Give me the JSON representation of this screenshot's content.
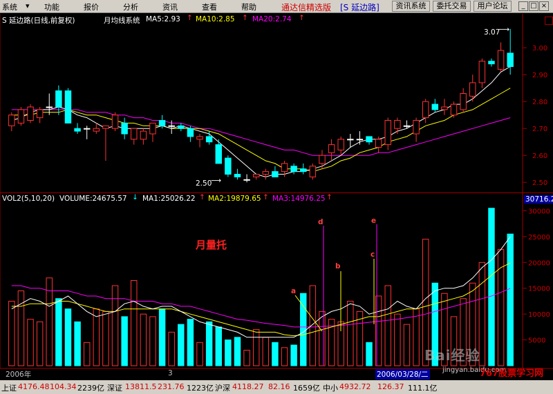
{
  "menubar": {
    "items": [
      "系统",
      "功能",
      "报价",
      "分析",
      "资讯",
      "查看",
      "帮助"
    ],
    "app_title": "通达信精选版",
    "stock_tag": "[S 延边路]",
    "tools": [
      "资讯系统",
      "委托交易",
      "用户论坛"
    ],
    "window_controls": [
      "_",
      "□",
      "×"
    ]
  },
  "price_panel": {
    "stock_name": "S 延边路(日线,前复权)",
    "indicator_name": "月均线系统",
    "ma5_label": "MA5:2.93",
    "ma10_label": "MA10:2.85",
    "ma20_label": "MA20:2.74",
    "high_label": "3.07",
    "low_label": "2.50",
    "y_ticks": [
      "3.00",
      "2.90",
      "2.80",
      "2.70",
      "2.60",
      "2.50"
    ],
    "colors": {
      "ma5": "#ffffff",
      "ma10": "#ffff00",
      "ma20": "#ff00ff",
      "up": "#ff3232",
      "down": "#00ffff"
    }
  },
  "volume_panel": {
    "header": "VOL2(5,10,20)",
    "volume_label": "VOLUME:24675.57",
    "ma1_label": "MA1:25026.22",
    "ma2_label": "MA2:19879.65",
    "ma3_label": "MA3:14976.25",
    "max_label": "30716.2",
    "y_ticks": [
      "30000",
      "25000",
      "20000",
      "15000",
      "10000",
      "5000"
    ],
    "annotation": "月量托",
    "markers": [
      "a",
      "b",
      "c",
      "d",
      "e"
    ],
    "date_left": "2006年",
    "date_mid": "3",
    "date_cursor": "2006/03/28/二"
  },
  "watermarks": {
    "baidu": "Bai经验",
    "url": "jingyan.baidu.com",
    "site": "767股票学习网"
  },
  "statusbar": {
    "sh_label": "上证",
    "sh_value": "4176.48",
    "sh_change": "104.34",
    "sh_amount": "2239亿",
    "sz_label": "深证",
    "sz_value": "13811.5",
    "sz_change": "231.76",
    "sz_amount": "1223亿",
    "hs_label": "沪深",
    "hs_value": "4118.27",
    "hs_change": "82.16",
    "hs_amount": "1659亿",
    "zx_label": "中小",
    "zx_value": "4932.72",
    "zx_change": "126.37",
    "zx_amount": "111.1亿"
  },
  "chart_data": {
    "type": "candlestick+volume",
    "title": "S 延边路(日线,前复权)",
    "price_ylim": [
      2.48,
      3.08
    ],
    "candles": [
      {
        "o": 2.71,
        "h": 2.76,
        "l": 2.69,
        "c": 2.75
      },
      {
        "o": 2.72,
        "h": 2.78,
        "l": 2.71,
        "c": 2.77
      },
      {
        "o": 2.73,
        "h": 2.79,
        "l": 2.72,
        "c": 2.78
      },
      {
        "o": 2.74,
        "h": 2.78,
        "l": 2.72,
        "c": 2.77
      },
      {
        "o": 2.78,
        "h": 2.83,
        "l": 2.75,
        "c": 2.78
      },
      {
        "o": 2.84,
        "h": 2.86,
        "l": 2.75,
        "c": 2.78
      },
      {
        "o": 2.84,
        "h": 2.85,
        "l": 2.72,
        "c": 2.72
      },
      {
        "o": 2.7,
        "h": 2.72,
        "l": 2.68,
        "c": 2.69
      },
      {
        "o": 2.7,
        "h": 2.71,
        "l": 2.66,
        "c": 2.7
      },
      {
        "o": 2.69,
        "h": 2.72,
        "l": 2.68,
        "c": 2.7
      },
      {
        "o": 2.7,
        "h": 2.71,
        "l": 2.58,
        "c": 2.71
      },
      {
        "o": 2.7,
        "h": 2.76,
        "l": 2.69,
        "c": 2.75
      },
      {
        "o": 2.72,
        "h": 2.74,
        "l": 2.66,
        "c": 2.68
      },
      {
        "o": 2.66,
        "h": 2.7,
        "l": 2.64,
        "c": 2.7
      },
      {
        "o": 2.66,
        "h": 2.7,
        "l": 2.64,
        "c": 2.69
      },
      {
        "o": 2.68,
        "h": 2.71,
        "l": 2.65,
        "c": 2.72
      },
      {
        "o": 2.73,
        "h": 2.75,
        "l": 2.7,
        "c": 2.71
      },
      {
        "o": 2.71,
        "h": 2.73,
        "l": 2.68,
        "c": 2.71
      },
      {
        "o": 2.71,
        "h": 2.72,
        "l": 2.69,
        "c": 2.7
      },
      {
        "o": 2.7,
        "h": 2.71,
        "l": 2.65,
        "c": 2.67
      },
      {
        "o": 2.66,
        "h": 2.68,
        "l": 2.63,
        "c": 2.67
      },
      {
        "o": 2.67,
        "h": 2.69,
        "l": 2.64,
        "c": 2.65
      },
      {
        "o": 2.64,
        "h": 2.66,
        "l": 2.57,
        "c": 2.57
      },
      {
        "o": 2.59,
        "h": 2.6,
        "l": 2.52,
        "c": 2.53
      },
      {
        "o": 2.53,
        "h": 2.55,
        "l": 2.51,
        "c": 2.52
      },
      {
        "o": 2.51,
        "h": 2.53,
        "l": 2.5,
        "c": 2.51
      },
      {
        "o": 2.52,
        "h": 2.53,
        "l": 2.51,
        "c": 2.53
      },
      {
        "o": 2.53,
        "h": 2.55,
        "l": 2.51,
        "c": 2.54
      },
      {
        "o": 2.54,
        "h": 2.56,
        "l": 2.52,
        "c": 2.52
      },
      {
        "o": 2.54,
        "h": 2.58,
        "l": 2.52,
        "c": 2.57
      },
      {
        "o": 2.56,
        "h": 2.57,
        "l": 2.53,
        "c": 2.54
      },
      {
        "o": 2.55,
        "h": 2.57,
        "l": 2.53,
        "c": 2.54
      },
      {
        "o": 2.52,
        "h": 2.57,
        "l": 2.51,
        "c": 2.56
      },
      {
        "o": 2.57,
        "h": 2.62,
        "l": 2.55,
        "c": 2.6
      },
      {
        "o": 2.61,
        "h": 2.66,
        "l": 2.58,
        "c": 2.64
      },
      {
        "o": 2.62,
        "h": 2.67,
        "l": 2.6,
        "c": 2.66
      },
      {
        "o": 2.66,
        "h": 2.68,
        "l": 2.63,
        "c": 2.66
      },
      {
        "o": 2.66,
        "h": 2.69,
        "l": 2.64,
        "c": 2.66
      },
      {
        "o": 2.67,
        "h": 2.67,
        "l": 2.64,
        "c": 2.65
      },
      {
        "o": 2.63,
        "h": 2.67,
        "l": 2.61,
        "c": 2.66
      },
      {
        "o": 2.64,
        "h": 2.74,
        "l": 2.62,
        "c": 2.73
      },
      {
        "o": 2.7,
        "h": 2.74,
        "l": 2.68,
        "c": 2.73
      },
      {
        "o": 2.71,
        "h": 2.73,
        "l": 2.7,
        "c": 2.71
      },
      {
        "o": 2.68,
        "h": 2.74,
        "l": 2.65,
        "c": 2.73
      },
      {
        "o": 2.74,
        "h": 2.81,
        "l": 2.72,
        "c": 2.8
      },
      {
        "o": 2.79,
        "h": 2.81,
        "l": 2.76,
        "c": 2.77
      },
      {
        "o": 2.77,
        "h": 2.81,
        "l": 2.75,
        "c": 2.78
      },
      {
        "o": 2.75,
        "h": 2.8,
        "l": 2.74,
        "c": 2.79
      },
      {
        "o": 2.77,
        "h": 2.85,
        "l": 2.76,
        "c": 2.83
      },
      {
        "o": 2.82,
        "h": 2.9,
        "l": 2.8,
        "c": 2.87
      },
      {
        "o": 2.87,
        "h": 2.96,
        "l": 2.85,
        "c": 2.95
      },
      {
        "o": 2.95,
        "h": 2.96,
        "l": 2.93,
        "c": 2.94
      },
      {
        "o": 2.92,
        "h": 3.02,
        "l": 2.91,
        "c": 2.99
      },
      {
        "o": 2.98,
        "h": 3.07,
        "l": 2.9,
        "c": 2.93
      }
    ],
    "ma5": [
      2.73,
      2.74,
      2.76,
      2.77,
      2.77,
      2.78,
      2.77,
      2.75,
      2.74,
      2.72,
      2.7,
      2.71,
      2.7,
      2.7,
      2.7,
      2.7,
      2.71,
      2.7,
      2.71,
      2.7,
      2.69,
      2.68,
      2.65,
      2.62,
      2.59,
      2.56,
      2.53,
      2.52,
      2.53,
      2.53,
      2.54,
      2.54,
      2.55,
      2.56,
      2.58,
      2.6,
      2.63,
      2.65,
      2.66,
      2.66,
      2.67,
      2.69,
      2.7,
      2.72,
      2.74,
      2.76,
      2.77,
      2.79,
      2.79,
      2.81,
      2.84,
      2.87,
      2.91,
      2.93
    ],
    "ma10": [
      2.75,
      2.75,
      2.75,
      2.76,
      2.76,
      2.76,
      2.77,
      2.76,
      2.75,
      2.75,
      2.74,
      2.73,
      2.72,
      2.72,
      2.71,
      2.71,
      2.71,
      2.7,
      2.7,
      2.7,
      2.7,
      2.69,
      2.68,
      2.66,
      2.64,
      2.62,
      2.6,
      2.58,
      2.57,
      2.55,
      2.55,
      2.55,
      2.54,
      2.55,
      2.56,
      2.58,
      2.59,
      2.61,
      2.62,
      2.63,
      2.65,
      2.66,
      2.67,
      2.69,
      2.71,
      2.72,
      2.73,
      2.75,
      2.76,
      2.77,
      2.79,
      2.81,
      2.83,
      2.85
    ],
    "ma20": [
      2.77,
      2.77,
      2.77,
      2.77,
      2.77,
      2.77,
      2.77,
      2.77,
      2.76,
      2.76,
      2.76,
      2.75,
      2.75,
      2.74,
      2.74,
      2.73,
      2.73,
      2.72,
      2.72,
      2.71,
      2.7,
      2.7,
      2.69,
      2.68,
      2.67,
      2.66,
      2.65,
      2.64,
      2.63,
      2.62,
      2.62,
      2.61,
      2.6,
      2.6,
      2.6,
      2.6,
      2.6,
      2.6,
      2.6,
      2.61,
      2.61,
      2.62,
      2.63,
      2.64,
      2.65,
      2.66,
      2.67,
      2.68,
      2.69,
      2.7,
      2.71,
      2.72,
      2.73,
      2.74
    ],
    "volume_ylim": [
      0,
      31000
    ],
    "volumes": [
      12500,
      14500,
      9000,
      8500,
      17000,
      13000,
      11000,
      8500,
      4500,
      11000,
      10500,
      15500,
      9500,
      16500,
      10000,
      9500,
      11000,
      6500,
      8000,
      9000,
      4500,
      8500,
      7500,
      5000,
      5500,
      3000,
      7000,
      5500,
      4500,
      3500,
      4000,
      14000,
      15500,
      10500,
      9000,
      8500,
      12500,
      10500,
      4500,
      13500,
      15500,
      10000,
      8000,
      11000,
      24500,
      16000,
      14000,
      9500,
      13000,
      16000,
      20000,
      30500,
      22500,
      25500
    ],
    "vol_ma1": [
      11000,
      12000,
      13000,
      12500,
      11500,
      12500,
      13500,
      12000,
      10500,
      9500,
      10000,
      10500,
      12000,
      12500,
      11500,
      11000,
      11500,
      11500,
      10500,
      9500,
      8500,
      8000,
      7500,
      7000,
      6500,
      5500,
      5500,
      5500,
      5500,
      5500,
      5500,
      6500,
      8000,
      9500,
      10500,
      11000,
      12000,
      11500,
      10000,
      10500,
      11000,
      12500,
      11500,
      11000,
      13000,
      14500,
      15000,
      15000,
      15500,
      17000,
      19000,
      20500,
      22500,
      25000
    ],
    "vol_ma2": [
      11500,
      11500,
      12000,
      12000,
      12000,
      12500,
      12500,
      12000,
      11500,
      11000,
      10500,
      10500,
      11000,
      11000,
      11000,
      11000,
      11000,
      11000,
      10500,
      10000,
      9500,
      9000,
      8500,
      8000,
      7500,
      7000,
      6500,
      6500,
      6500,
      6000,
      5800,
      6000,
      6500,
      7000,
      7500,
      8000,
      8500,
      9000,
      9500,
      9500,
      10000,
      10500,
      11000,
      11000,
      11500,
      12000,
      12500,
      13000,
      13500,
      14500,
      16000,
      17500,
      19000,
      19900
    ],
    "vol_ma3": [
      15500,
      15500,
      15000,
      15000,
      14500,
      14500,
      14500,
      14000,
      13500,
      13500,
      13000,
      13000,
      13000,
      12500,
      12500,
      12500,
      12000,
      12000,
      11500,
      11500,
      11000,
      10500,
      10000,
      9500,
      9000,
      8800,
      8500,
      8200,
      8000,
      7800,
      7500,
      7500,
      7500,
      7600,
      7700,
      7800,
      8000,
      8200,
      8400,
      8600,
      8800,
      9000,
      9300,
      9600,
      10000,
      10500,
      11000,
      11500,
      12000,
      12500,
      13000,
      13500,
      14200,
      14976
    ]
  }
}
